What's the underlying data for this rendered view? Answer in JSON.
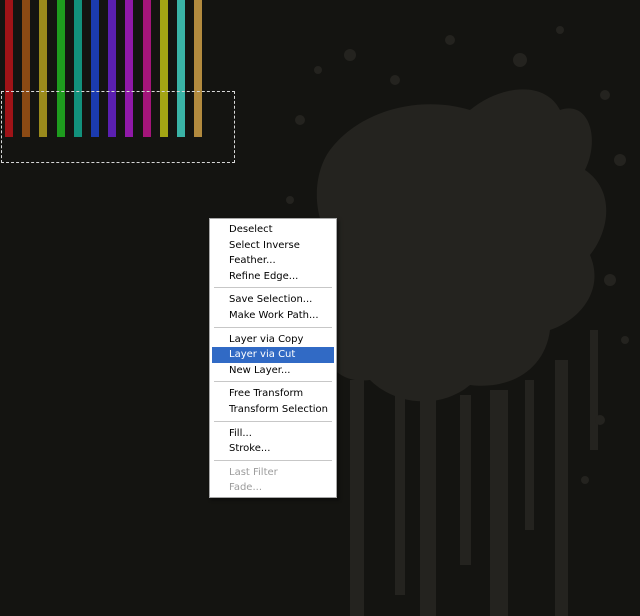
{
  "canvas": {
    "background": "#141411",
    "splatter_color": "#24231f",
    "stripes": [
      "#a01317",
      "#8b4a14",
      "#9a8a1c",
      "#1e9c1e",
      "#12917c",
      "#1b3bb0",
      "#5a1fb0",
      "#9019a8",
      "#a4157a",
      "#a3a514",
      "#3ab3a6",
      "#b28a3e"
    ]
  },
  "context_menu": {
    "groups": [
      [
        {
          "label": "Deselect",
          "state": "enabled"
        },
        {
          "label": "Select Inverse",
          "state": "enabled"
        },
        {
          "label": "Feather...",
          "state": "enabled"
        },
        {
          "label": "Refine Edge...",
          "state": "enabled"
        }
      ],
      [
        {
          "label": "Save Selection...",
          "state": "enabled"
        },
        {
          "label": "Make Work Path...",
          "state": "enabled"
        }
      ],
      [
        {
          "label": "Layer via Copy",
          "state": "enabled"
        },
        {
          "label": "Layer via Cut",
          "state": "selected"
        },
        {
          "label": "New Layer...",
          "state": "enabled"
        }
      ],
      [
        {
          "label": "Free Transform",
          "state": "enabled"
        },
        {
          "label": "Transform Selection",
          "state": "enabled"
        }
      ],
      [
        {
          "label": "Fill...",
          "state": "enabled"
        },
        {
          "label": "Stroke...",
          "state": "enabled"
        }
      ],
      [
        {
          "label": "Last Filter",
          "state": "disabled"
        },
        {
          "label": "Fade...",
          "state": "disabled"
        }
      ]
    ],
    "selected_color": "#316ac5"
  }
}
